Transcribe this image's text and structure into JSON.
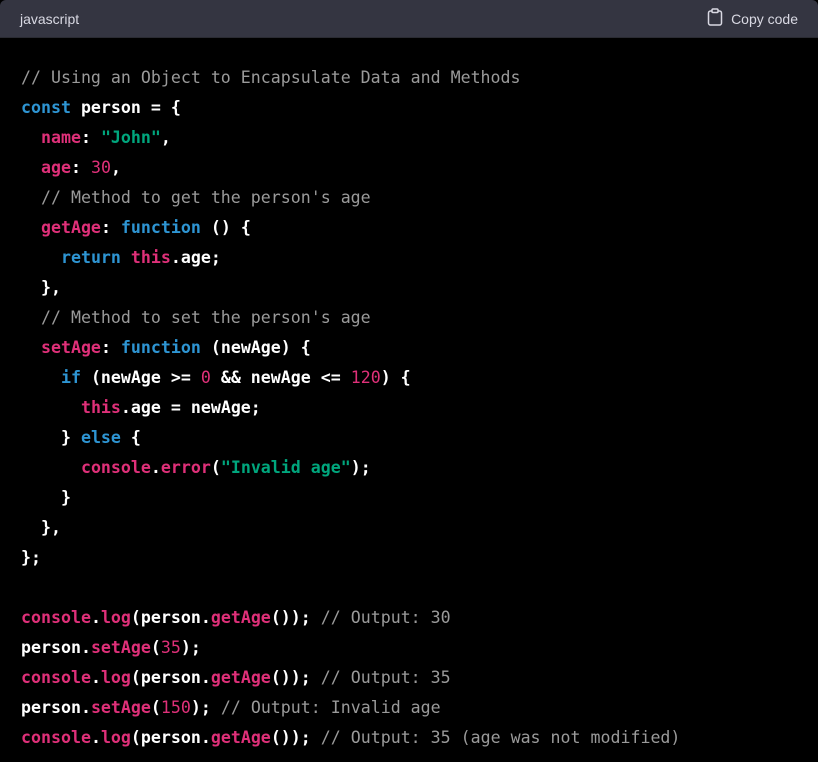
{
  "header": {
    "language": "javascript",
    "copy_label": "Copy code",
    "copy_icon": "clipboard-icon"
  },
  "colors": {
    "header_bg": "#343541",
    "code_bg": "#000000",
    "comment": "#9a9a9a",
    "keyword": "#2e95d3",
    "property": "#df3079",
    "string": "#00a67d",
    "number": "#df3079",
    "plain": "#ffffff"
  },
  "code_lines": [
    [
      [
        "comment",
        "// Using an Object to Encapsulate Data and Methods"
      ]
    ],
    [
      [
        "keyword",
        "const"
      ],
      [
        "plain",
        " person = {"
      ]
    ],
    [
      [
        "plain",
        "  "
      ],
      [
        "prop",
        "name"
      ],
      [
        "plain",
        ": "
      ],
      [
        "string",
        "\"John\""
      ],
      [
        "plain",
        ","
      ]
    ],
    [
      [
        "plain",
        "  "
      ],
      [
        "prop",
        "age"
      ],
      [
        "plain",
        ": "
      ],
      [
        "number",
        "30"
      ],
      [
        "plain",
        ","
      ]
    ],
    [
      [
        "plain",
        "  "
      ],
      [
        "comment",
        "// Method to get the person's age"
      ]
    ],
    [
      [
        "plain",
        "  "
      ],
      [
        "prop",
        "getAge"
      ],
      [
        "plain",
        ": "
      ],
      [
        "keyword",
        "function"
      ],
      [
        "plain",
        " () {"
      ]
    ],
    [
      [
        "plain",
        "    "
      ],
      [
        "keyword",
        "return"
      ],
      [
        "plain",
        " "
      ],
      [
        "prop",
        "this"
      ],
      [
        "plain",
        ".age;"
      ]
    ],
    [
      [
        "plain",
        "  },"
      ]
    ],
    [
      [
        "plain",
        "  "
      ],
      [
        "comment",
        "// Method to set the person's age"
      ]
    ],
    [
      [
        "plain",
        "  "
      ],
      [
        "prop",
        "setAge"
      ],
      [
        "plain",
        ": "
      ],
      [
        "keyword",
        "function"
      ],
      [
        "plain",
        " (newAge) {"
      ]
    ],
    [
      [
        "plain",
        "    "
      ],
      [
        "keyword",
        "if"
      ],
      [
        "plain",
        " (newAge >= "
      ],
      [
        "number",
        "0"
      ],
      [
        "plain",
        " && newAge <= "
      ],
      [
        "number",
        "120"
      ],
      [
        "plain",
        ") {"
      ]
    ],
    [
      [
        "plain",
        "      "
      ],
      [
        "prop",
        "this"
      ],
      [
        "plain",
        ".age = newAge;"
      ]
    ],
    [
      [
        "plain",
        "    } "
      ],
      [
        "keyword",
        "else"
      ],
      [
        "plain",
        " {"
      ]
    ],
    [
      [
        "plain",
        "      "
      ],
      [
        "prop",
        "console"
      ],
      [
        "plain",
        "."
      ],
      [
        "prop",
        "error"
      ],
      [
        "plain",
        "("
      ],
      [
        "string",
        "\"Invalid age\""
      ],
      [
        "plain",
        ");"
      ]
    ],
    [
      [
        "plain",
        "    }"
      ]
    ],
    [
      [
        "plain",
        "  },"
      ]
    ],
    [
      [
        "plain",
        "};"
      ]
    ],
    [
      [
        "plain",
        ""
      ]
    ],
    [
      [
        "prop",
        "console"
      ],
      [
        "plain",
        "."
      ],
      [
        "prop",
        "log"
      ],
      [
        "plain",
        "(person."
      ],
      [
        "prop",
        "getAge"
      ],
      [
        "plain",
        "()); "
      ],
      [
        "comment",
        "// Output: 30"
      ]
    ],
    [
      [
        "plain",
        "person."
      ],
      [
        "prop",
        "setAge"
      ],
      [
        "plain",
        "("
      ],
      [
        "number",
        "35"
      ],
      [
        "plain",
        ");"
      ]
    ],
    [
      [
        "prop",
        "console"
      ],
      [
        "plain",
        "."
      ],
      [
        "prop",
        "log"
      ],
      [
        "plain",
        "(person."
      ],
      [
        "prop",
        "getAge"
      ],
      [
        "plain",
        "()); "
      ],
      [
        "comment",
        "// Output: 35"
      ]
    ],
    [
      [
        "plain",
        "person."
      ],
      [
        "prop",
        "setAge"
      ],
      [
        "plain",
        "("
      ],
      [
        "number",
        "150"
      ],
      [
        "plain",
        "); "
      ],
      [
        "comment",
        "// Output: Invalid age"
      ]
    ],
    [
      [
        "prop",
        "console"
      ],
      [
        "plain",
        "."
      ],
      [
        "prop",
        "log"
      ],
      [
        "plain",
        "(person."
      ],
      [
        "prop",
        "getAge"
      ],
      [
        "plain",
        "()); "
      ],
      [
        "comment",
        "// Output: 35 (age was not modified)"
      ]
    ]
  ]
}
